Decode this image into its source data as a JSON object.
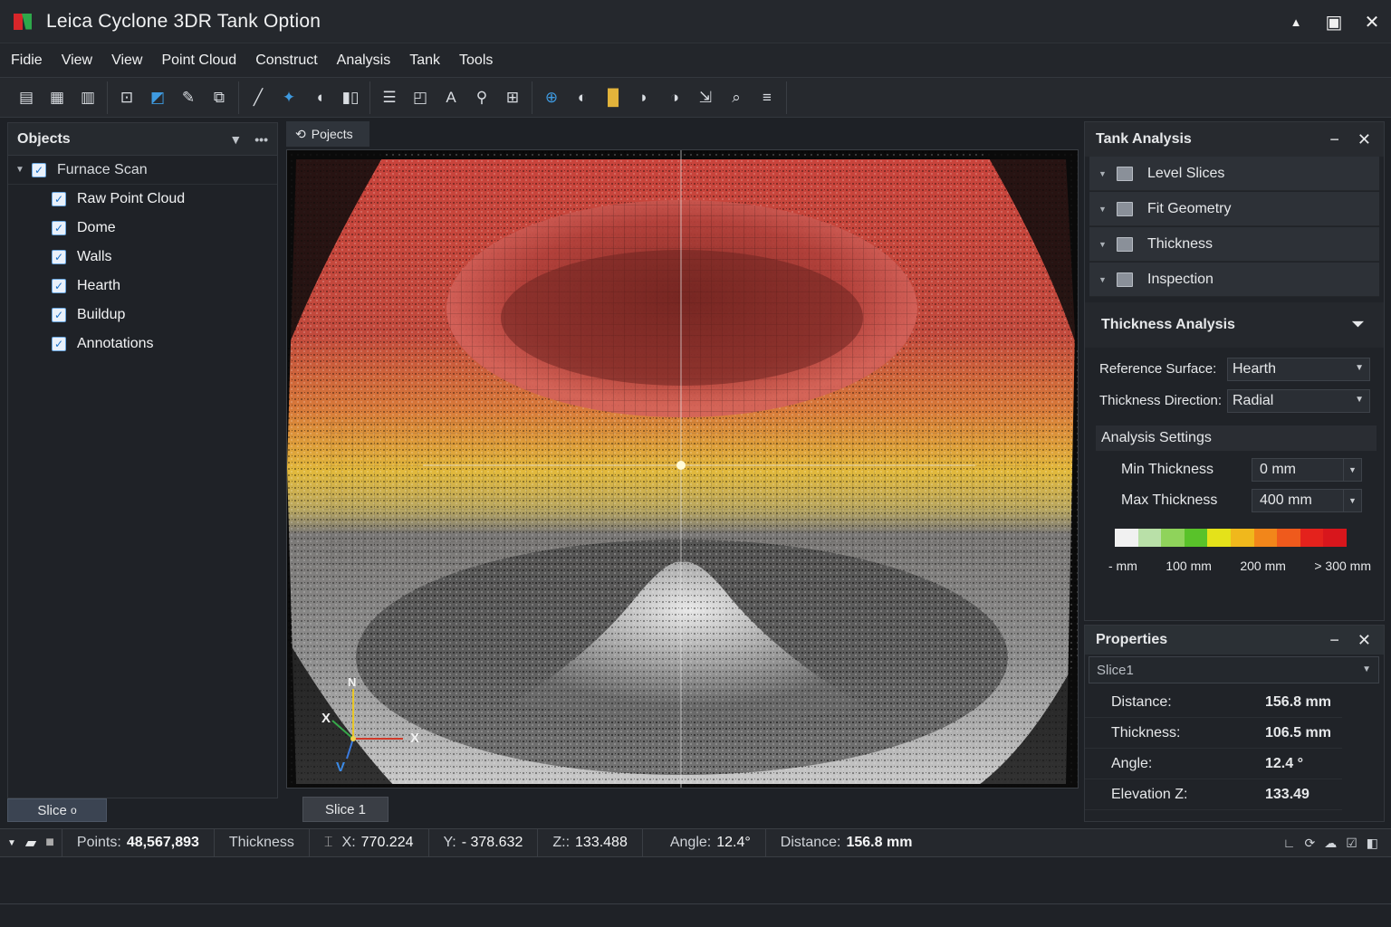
{
  "window": {
    "title": "Leica Cyclone 3DR  Tank Option",
    "controls": [
      "▲",
      "▣",
      "✕"
    ]
  },
  "menu": [
    "Fidie",
    "View",
    "View",
    "Point Cloud",
    "Construct",
    "Analysis",
    "Tank",
    "Tools"
  ],
  "objects_panel": {
    "title": "Objects",
    "root": "Furnace Scan",
    "items": [
      "Raw Point Cloud",
      "Dome",
      "Walls",
      "Hearth",
      "Buildup",
      "Annotations"
    ],
    "slice_tab": "Slice",
    "slice_tab_suffix": "o"
  },
  "viewport": {
    "tab_label": "Pojects",
    "slice_tab": "Slice 1",
    "axis_labels": {
      "north": "N",
      "left": "X",
      "right": "X",
      "bottom": "V"
    }
  },
  "tank_analysis": {
    "title": "Tank Analysis",
    "tools": [
      "Level Slices",
      "Fit Geometry",
      "Thickness",
      "Inspection"
    ],
    "section_title": "Thickness Analysis",
    "reference_surface_label": "Reference Surface:",
    "reference_surface_value": "Hearth",
    "thickness_direction_label": "Thickness Direction:",
    "thickness_direction_value": "Radial",
    "settings_title": "Analysis Settings",
    "min_label": "Min Thickness",
    "min_value": "0 mm",
    "max_label": "Max Thickness",
    "max_value": "400 mm",
    "scale_colors": [
      "#f1f1f1",
      "#b9e0a8",
      "#8fd35b",
      "#59c22a",
      "#e4e21a",
      "#f0b81c",
      "#f2861a",
      "#ef5a1c",
      "#e4221c",
      "#d8161c"
    ],
    "scale_labels": [
      "- mm",
      "100 mm",
      "200 mm",
      "> 300 mm"
    ]
  },
  "properties": {
    "title": "Properties",
    "selector": "Slice1",
    "rows": [
      {
        "label": "Distance:",
        "value": "156.8 mm"
      },
      {
        "label": "Thickness:",
        "value": "106.5 mm"
      },
      {
        "label": "Angle:",
        "value": "12.4 °"
      },
      {
        "label": "Elevation Z:",
        "value": "133.49"
      }
    ]
  },
  "status": {
    "points_label": "Points:",
    "points_value": "48,567,893",
    "mode": "Thickness",
    "x_label": "X:",
    "x_value": "770.224",
    "y_label": "Y:",
    "y_value": "- 378.632",
    "z_label": "Z::",
    "z_value": "133.488",
    "angle_label": "Angle:",
    "angle_value": "12.4°",
    "distance_label": "Distance:",
    "distance_value": "156.8 mm"
  }
}
